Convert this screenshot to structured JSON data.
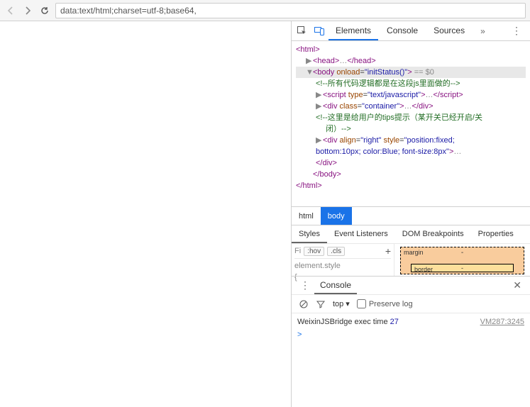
{
  "url": "data:text/html;charset=utf-8;base64,",
  "devtools": {
    "tabs": {
      "elements": "Elements",
      "console": "Console",
      "sources": "Sources",
      "more": "»"
    },
    "dom": {
      "l1": "<html>",
      "l2_open": "<head>",
      "l2_ell": "…",
      "l2_close": "</head>",
      "l3_open": "<body ",
      "l3_attr": "onload",
      "l3_val": "\"initStatus()\"",
      "l3_close": ">",
      "l3_eq": " == $0",
      "l4": "<!--所有代码逻辑都是在这段js里面做的-->",
      "l5_open": "<script ",
      "l5_a1": "type",
      "l5_v1": "\"text/javascript\"",
      "l5_close1": ">",
      "l5_ell": "…",
      "l5_close2": "</script>",
      "l6_open": "<div ",
      "l6_a1": "class",
      "l6_v1": "\"container\"",
      "l6_close1": ">",
      "l6_ell": "…",
      "l6_close2": "</div>",
      "l7a": "<!--这里是给用户的tips提示（某开关已经开启/关",
      "l7b": "闭）-->",
      "l8_open": "<div ",
      "l8_a1": "align",
      "l8_v1": "\"right\"",
      "l8_a2": " style",
      "l8_v2": "\"position:fixed;",
      "l8_line2": "bottom:10px; color:Blue; font-size:8px\"",
      "l8_close1": ">",
      "l8_ell": "…",
      "l8_close2": "</div>",
      "l9": "</body>",
      "l10": "</html>"
    },
    "breadcrumb": {
      "html": "html",
      "body": "body"
    },
    "styles": {
      "tabs": {
        "styles": "Styles",
        "events": "Event Listeners",
        "domb": "DOM Breakpoints",
        "props": "Properties"
      },
      "filter": "Fi",
      "hov": ":hov",
      "cls": ".cls",
      "elstyle": "element.style",
      "box": {
        "margin": "margin",
        "border": "border",
        "dash": "-"
      }
    },
    "console": {
      "tab": "Console",
      "scope": "top",
      "preserve": "Preserve log",
      "msg_text": "WeixinJSBridge exec time ",
      "msg_num": "27",
      "src": "VM287:3245",
      "prompt": ">"
    }
  }
}
